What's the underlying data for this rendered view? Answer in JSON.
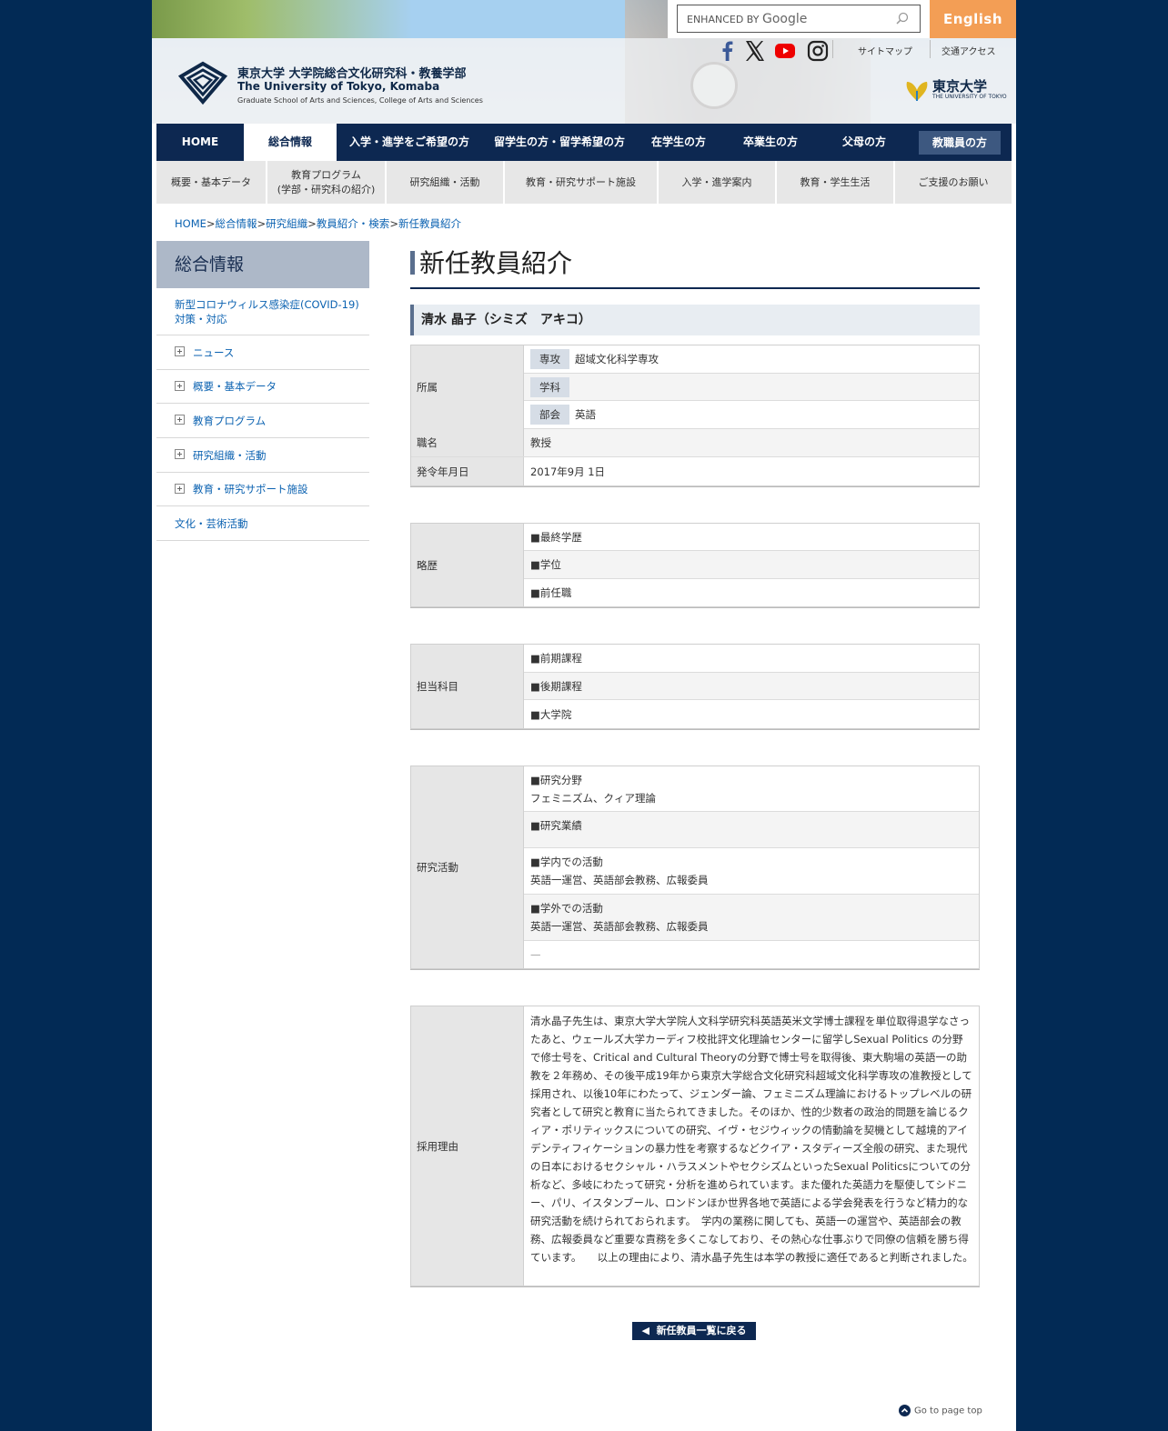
{
  "header": {
    "search": {
      "placeholder": "ENHANCED BY Google",
      "brand_prefix": "ENHANCED BY",
      "brand": "Google"
    },
    "english_link": "English",
    "social_icons": [
      "facebook-icon",
      "x-icon",
      "youtube-icon",
      "instagram-icon"
    ],
    "sitemap": "サイトマップ",
    "access": "交通アクセス",
    "logo": {
      "jp": "東京大学 大学院総合文化研究科・教養学部",
      "en": "The University of Tokyo, Komaba",
      "sub": "Graduate School of Arts and Sciences, College of Arts and Sciences"
    },
    "utokyo": {
      "title": "東京大学",
      "sub": "THE UNIVERSITY OF TOKYO"
    }
  },
  "global_nav": [
    "HOME",
    "総合情報",
    "入学・進学をご希望の方",
    "留学生の方・留学希望の方",
    "在学生の方",
    "卒業生の方",
    "父母の方",
    "教職員の方"
  ],
  "sub_nav": [
    "概要・基本データ",
    "教育プログラム",
    "(学部・研究科の紹介)",
    "研究組織・活動",
    "教育・研究サポート施設",
    "入学・進学案内",
    "教育・学生生活",
    "ご支援のお願い"
  ],
  "breadcrumb": [
    "HOME",
    "総合情報",
    "研究組織",
    "教員紹介・検索",
    "新任教員紹介"
  ],
  "sidebar": {
    "title": "総合情報",
    "items": [
      {
        "label": "新型コロナウィルス感染症(COVID-19)",
        "label2": "対策・対応"
      },
      {
        "label": "ニュース"
      },
      {
        "label": "概要・基本データ"
      },
      {
        "label": "教育プログラム"
      },
      {
        "label": "研究組織・活動"
      },
      {
        "label": "教育・研究サポート施設"
      },
      {
        "label": "文化・芸術活動"
      }
    ]
  },
  "main": {
    "title": "新任教員紹介",
    "name": "清水 晶子（シミズ　アキコ）",
    "affiliation": {
      "label": "所属",
      "major_tag": "専攻",
      "major": "超域文化科学専攻",
      "dept_tag": "学科",
      "dept": "",
      "section_tag": "部会",
      "section": "英語"
    },
    "position": {
      "label": "職名",
      "value": "教授"
    },
    "date": {
      "label": "発令年月日",
      "value": "2017年9月 1日"
    },
    "career": {
      "label": "略歴",
      "rows": [
        "■最終学歴",
        "■学位",
        "■前任職"
      ]
    },
    "courses": {
      "label": "担当科目",
      "rows": [
        "■前期課程",
        "■後期課程",
        "■大学院"
      ]
    },
    "research": {
      "label": "研究活動",
      "field_h": "■研究分野",
      "field": "フェミニズム、クィア理論",
      "achievements_h": "■研究業績",
      "internal_h": "■学内での活動",
      "internal": "英語一運営、英語部会教務、広報委員",
      "external_h": "■学外での活動",
      "external": "英語一運営、英語部会教務、広報委員",
      "other": "—"
    },
    "reason": {
      "label": "採用理由",
      "text": "清水晶子先生は、東京大学大学院人文科学研究科英語英米文学博士課程を単位取得退学なさったあと、ウェールズ大学カーディフ校批評文化理論センターに留学しSexual Politics の分野で修士号を、Critical and Cultural Theoryの分野で博士号を取得後、東大駒場の英語一の助教を２年務め、その後平成19年から東京大学総合文化研究科超域文化科学専攻の准教授として採用され、以後10年にわたって、ジェンダー論、フェミニズム理論におけるトップレベルの研究者として研究と教育に当たられてきました。そのほか、性的少数者の政治的問題を論じるクィア・ポリティックスについての研究、イヴ・セジウィックの情動論を契機として越境的アイデンティフィケーションの暴力性を考察するなどクイア・スタディーズ全般の研究、また現代の日本におけるセクシャル・ハラスメントやセクシズムといったSexual Politicsについての分析など、多岐にわたって研究・分析を進められています。また優れた英語力を駆使してシドニー、パリ、イスタンブール、ロンドンほか世界各地で英語による学会発表を行うなど精力的な研究活動を続けられておられます。　学内の業務に関しても、英語一の運営や、英語部会の教務、広報委員など重要な責務を多くこなしており、その熱心な仕事ぶりで同僚の信頼を勝ち得ています。　　以上の理由により、清水晶子先生は本学の教授に適任であると判断されました。"
    },
    "back_button": "新任教員一覧に戻る"
  },
  "page_top": "Go to page top",
  "colors": {
    "navy": "#0d2851",
    "accent": "#f39e55",
    "link": "#0b62b1"
  }
}
